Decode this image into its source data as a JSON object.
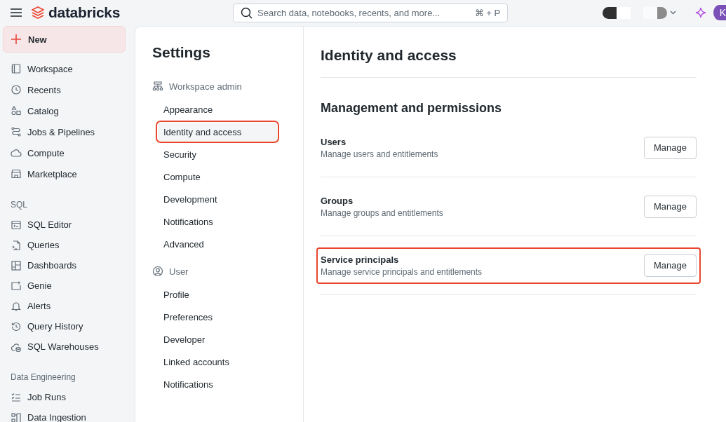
{
  "topbar": {
    "logo": "databricks",
    "search": {
      "placeholder": "Search data, notebooks, recents, and more...",
      "shortcut": "⌘ + P"
    },
    "avatar": "K"
  },
  "sidebar": {
    "new_button": "New",
    "sections": [
      {
        "items": [
          "Workspace",
          "Recents",
          "Catalog",
          "Jobs & Pipelines",
          "Compute",
          "Marketplace"
        ]
      },
      {
        "title": "SQL",
        "items": [
          "SQL Editor",
          "Queries",
          "Dashboards",
          "Genie",
          "Alerts",
          "Query History",
          "SQL Warehouses"
        ]
      },
      {
        "title": "Data Engineering",
        "items": [
          "Job Runs",
          "Data Ingestion"
        ]
      }
    ]
  },
  "settings": {
    "title": "Settings",
    "groups": [
      {
        "title": "Workspace admin",
        "items": [
          {
            "label": "Appearance",
            "selected": false,
            "highlighted": false
          },
          {
            "label": "Identity and access",
            "selected": true,
            "highlighted": true
          },
          {
            "label": "Security",
            "selected": false,
            "highlighted": false
          },
          {
            "label": "Compute",
            "selected": false,
            "highlighted": false
          },
          {
            "label": "Development",
            "selected": false,
            "highlighted": false
          },
          {
            "label": "Notifications",
            "selected": false,
            "highlighted": false
          },
          {
            "label": "Advanced",
            "selected": false,
            "highlighted": false
          }
        ]
      },
      {
        "title": "User",
        "items": [
          {
            "label": "Profile",
            "selected": false,
            "highlighted": false
          },
          {
            "label": "Preferences",
            "selected": false,
            "highlighted": false
          },
          {
            "label": "Developer",
            "selected": false,
            "highlighted": false
          },
          {
            "label": "Linked accounts",
            "selected": false,
            "highlighted": false
          },
          {
            "label": "Notifications",
            "selected": false,
            "highlighted": false
          }
        ]
      }
    ]
  },
  "content": {
    "title": "Identity and access",
    "section": "Management and permissions",
    "rows": [
      {
        "name": "Users",
        "description": "Manage users and entitlements",
        "button": "Manage",
        "highlighted": false
      },
      {
        "name": "Groups",
        "description": "Manage groups and entitlements",
        "button": "Manage",
        "highlighted": false
      },
      {
        "name": "Service principals",
        "description": "Manage service principals and entitlements",
        "button": "Manage",
        "highlighted": true
      }
    ]
  }
}
